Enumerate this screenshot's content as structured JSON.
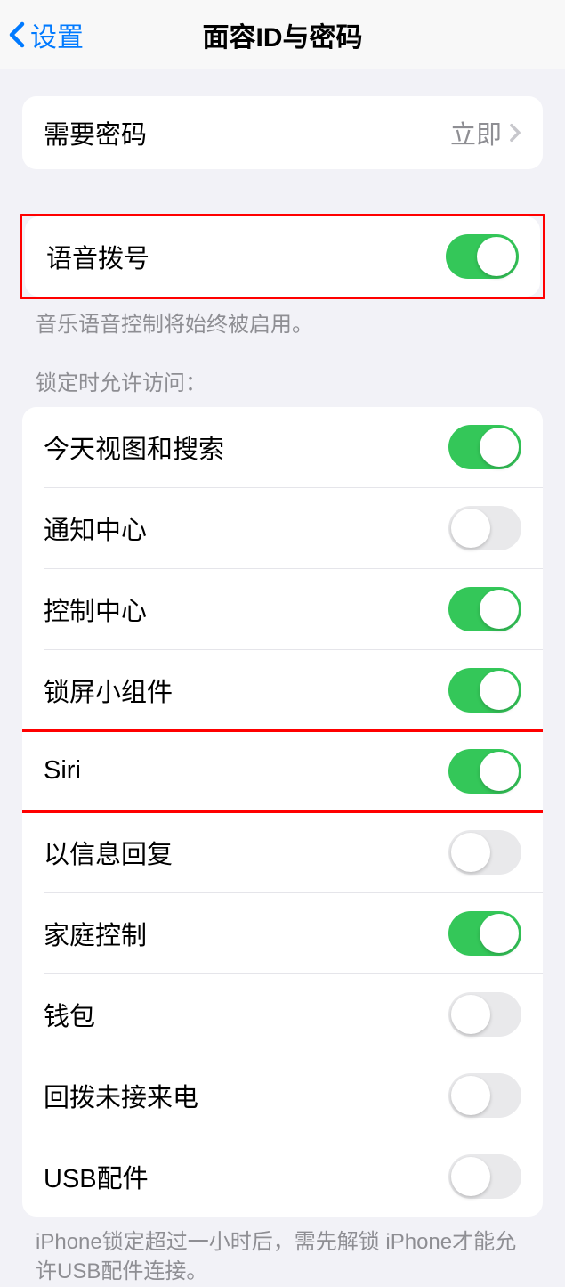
{
  "nav": {
    "back_label": "设置",
    "title": "面容ID与密码"
  },
  "require_passcode": {
    "label": "需要密码",
    "value": "立即"
  },
  "voice_dial": {
    "label": "语音拨号",
    "on": true,
    "footer": "音乐语音控制将始终被启用。"
  },
  "lock_access": {
    "header": "锁定时允许访问：",
    "items": [
      {
        "label": "今天视图和搜索",
        "on": true
      },
      {
        "label": "通知中心",
        "on": false
      },
      {
        "label": "控制中心",
        "on": true
      },
      {
        "label": "锁屏小组件",
        "on": true
      },
      {
        "label": "Siri",
        "on": true
      },
      {
        "label": "以信息回复",
        "on": false
      },
      {
        "label": "家庭控制",
        "on": true
      },
      {
        "label": "钱包",
        "on": false
      },
      {
        "label": "回拨未接来电",
        "on": false
      },
      {
        "label": "USB配件",
        "on": false
      }
    ],
    "footer": "iPhone锁定超过一小时后，需先解锁 iPhone才能允许USB配件连接。"
  }
}
